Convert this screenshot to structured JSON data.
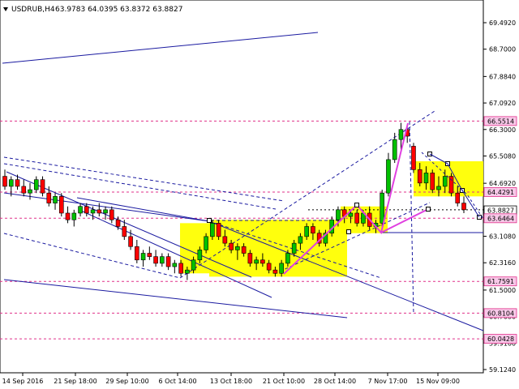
{
  "header": {
    "symbol": "USDRUB,H4",
    "ohlc": "63.9783 64.0395 63.8372 63.8827"
  },
  "colors": {
    "background": "#ffffff",
    "axis": "#000000",
    "candle_up": "#00c000",
    "candle_down": "#ff0000",
    "wick": "#000000",
    "trendline": "#1a1aa0",
    "level_line": "#e0308a",
    "magenta_path": "#e040e0",
    "highlight_zone": "#ffff00",
    "tag_magenta_bg": "#f8c8e8",
    "tag_white_bg": "#ffffff"
  },
  "chart_data": {
    "type": "candlestick",
    "symbol": "USDRUB",
    "timeframe": "H4",
    "last_bar": {
      "open": 63.9783,
      "high": 64.0395,
      "low": 63.8372,
      "close": 63.8827
    },
    "x_tick_labels": [
      "14 Sep 2016",
      "21 Sep 18:00",
      "29 Sep 10:00",
      "6 Oct 14:00",
      "13 Oct 18:00",
      "21 Oct 10:00",
      "28 Oct 14:00",
      "7 Nov 17:00",
      "15 Nov 09:00"
    ],
    "y_tick_labels": [
      "69.4920",
      "68.7000",
      "67.8840",
      "67.0920",
      "66.3000",
      "65.5080",
      "64.6920",
      "63.9000",
      "63.1080",
      "62.3160",
      "61.5000",
      "60.7080",
      "59.9160",
      "59.1240"
    ],
    "y_range": [
      59.124,
      69.492
    ],
    "price_tags": [
      {
        "label": "66.5514",
        "value": 66.5514,
        "style": "level"
      },
      {
        "label": "64.4291",
        "value": 64.4291,
        "style": "level"
      },
      {
        "label": "63.8827",
        "value": 63.8827,
        "style": "current"
      },
      {
        "label": "63.6464",
        "value": 63.6464,
        "style": "level"
      },
      {
        "label": "61.7591",
        "value": 61.7591,
        "style": "level"
      },
      {
        "label": "60.8104",
        "value": 60.8104,
        "style": "level"
      },
      {
        "label": "60.0428",
        "value": 60.0428,
        "style": "level"
      }
    ],
    "candles": [
      [
        64.9,
        65.1,
        64.5,
        64.6
      ],
      [
        64.6,
        64.9,
        64.3,
        64.8
      ],
      [
        64.8,
        64.95,
        64.5,
        64.6
      ],
      [
        64.6,
        64.8,
        64.3,
        64.4
      ],
      [
        64.4,
        64.7,
        64.2,
        64.5
      ],
      [
        64.5,
        64.9,
        64.4,
        64.8
      ],
      [
        64.8,
        64.9,
        64.3,
        64.4
      ],
      [
        64.4,
        64.6,
        64.0,
        64.1
      ],
      [
        64.1,
        64.4,
        63.9,
        64.3
      ],
      [
        64.3,
        64.4,
        63.7,
        63.8
      ],
      [
        63.8,
        64.0,
        63.5,
        63.6
      ],
      [
        63.6,
        63.9,
        63.4,
        63.8
      ],
      [
        63.8,
        64.1,
        63.7,
        64.0
      ],
      [
        64.0,
        64.1,
        63.7,
        63.8
      ],
      [
        63.8,
        64.0,
        63.6,
        63.9
      ],
      [
        63.9,
        64.1,
        63.7,
        63.8
      ],
      [
        63.8,
        64.0,
        63.6,
        63.9
      ],
      [
        63.9,
        64.0,
        63.5,
        63.6
      ],
      [
        63.6,
        63.7,
        63.3,
        63.4
      ],
      [
        63.4,
        63.6,
        63.0,
        63.1
      ],
      [
        63.1,
        63.3,
        62.7,
        62.8
      ],
      [
        62.8,
        63.0,
        62.3,
        62.4
      ],
      [
        62.4,
        62.7,
        62.2,
        62.6
      ],
      [
        62.6,
        62.8,
        62.4,
        62.5
      ],
      [
        62.5,
        62.7,
        62.2,
        62.3
      ],
      [
        62.3,
        62.6,
        62.2,
        62.5
      ],
      [
        62.5,
        62.6,
        62.1,
        62.2
      ],
      [
        62.2,
        62.4,
        62.0,
        62.3
      ],
      [
        62.3,
        62.4,
        61.9,
        62.0
      ],
      [
        62.0,
        62.2,
        61.8,
        62.1
      ],
      [
        62.1,
        62.5,
        62.0,
        62.4
      ],
      [
        62.4,
        62.8,
        62.3,
        62.7
      ],
      [
        62.7,
        63.2,
        62.6,
        63.1
      ],
      [
        63.1,
        63.6,
        63.0,
        63.5
      ],
      [
        63.5,
        63.6,
        63.0,
        63.1
      ],
      [
        63.1,
        63.3,
        62.8,
        62.9
      ],
      [
        62.9,
        63.0,
        62.6,
        62.7
      ],
      [
        62.7,
        62.9,
        62.4,
        62.8
      ],
      [
        62.8,
        62.9,
        62.5,
        62.6
      ],
      [
        62.6,
        62.7,
        62.2,
        62.3
      ],
      [
        62.3,
        62.5,
        62.1,
        62.4
      ],
      [
        62.4,
        62.6,
        62.2,
        62.3
      ],
      [
        62.3,
        62.4,
        62.0,
        62.1
      ],
      [
        62.1,
        62.2,
        61.9,
        62.0
      ],
      [
        62.0,
        62.4,
        61.9,
        62.3
      ],
      [
        62.3,
        62.7,
        62.2,
        62.6
      ],
      [
        62.6,
        63.0,
        62.5,
        62.9
      ],
      [
        62.9,
        63.2,
        62.7,
        63.1
      ],
      [
        63.1,
        63.5,
        63.0,
        63.4
      ],
      [
        63.4,
        63.5,
        63.0,
        63.2
      ],
      [
        63.2,
        63.3,
        62.8,
        62.9
      ],
      [
        62.9,
        63.3,
        62.8,
        63.2
      ],
      [
        63.2,
        63.7,
        63.1,
        63.6
      ],
      [
        63.6,
        64.0,
        63.4,
        63.9
      ],
      [
        63.9,
        64.0,
        63.5,
        63.7
      ],
      [
        63.7,
        63.9,
        63.5,
        63.8
      ],
      [
        63.8,
        63.9,
        63.4,
        63.5
      ],
      [
        63.5,
        63.9,
        63.4,
        63.8
      ],
      [
        63.8,
        64.0,
        63.3,
        63.4
      ],
      [
        63.4,
        63.6,
        63.2,
        63.5
      ],
      [
        63.5,
        64.5,
        63.4,
        64.4
      ],
      [
        64.4,
        65.6,
        64.3,
        65.4
      ],
      [
        65.4,
        66.2,
        65.3,
        66.0
      ],
      [
        66.0,
        66.5,
        65.7,
        66.3
      ],
      [
        66.3,
        66.45,
        65.9,
        66.1
      ],
      [
        65.8,
        65.9,
        65.0,
        65.1
      ],
      [
        65.1,
        65.3,
        64.6,
        64.7
      ],
      [
        64.7,
        65.2,
        64.5,
        65.0
      ],
      [
        65.0,
        65.1,
        64.4,
        64.5
      ],
      [
        64.5,
        64.9,
        64.3,
        64.6
      ],
      [
        64.6,
        65.1,
        64.4,
        64.9
      ],
      [
        64.9,
        65.0,
        64.3,
        64.4
      ],
      [
        64.4,
        64.6,
        64.0,
        64.1
      ],
      [
        64.1,
        64.3,
        63.8,
        63.9
      ]
    ]
  }
}
